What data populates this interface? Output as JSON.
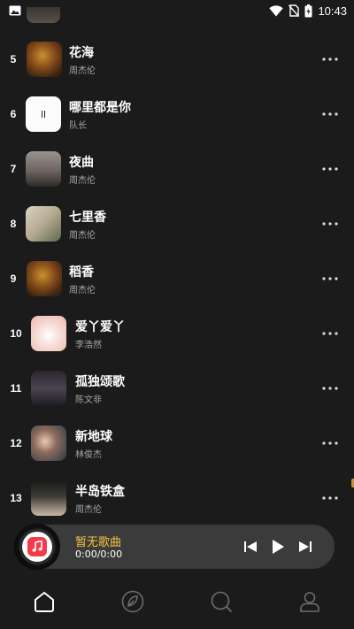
{
  "status_bar": {
    "time": "10:43",
    "icons": [
      "image-notification-icon",
      "wifi-icon",
      "no-sim-icon",
      "battery-charging-icon"
    ]
  },
  "songs": [
    {
      "index": "5",
      "title": "花海",
      "artist": "周杰伦",
      "cover": "flower-sea-cover"
    },
    {
      "index": "6",
      "title": "哪里都是你",
      "artist": "队长",
      "cover": "white-cover"
    },
    {
      "index": "7",
      "title": "夜曲",
      "artist": "周杰伦",
      "cover": "nocturne-cover"
    },
    {
      "index": "8",
      "title": "七里香",
      "artist": "周杰伦",
      "cover": "common-jasmine-cover"
    },
    {
      "index": "9",
      "title": "稻香",
      "artist": "周杰伦",
      "cover": "rice-field-cover"
    },
    {
      "index": "10",
      "title": "爱丫爱丫",
      "artist": "李浩然",
      "cover": "love-cover"
    },
    {
      "index": "11",
      "title": "孤独颂歌",
      "artist": "陈文非",
      "cover": "lonely-ode-cover"
    },
    {
      "index": "12",
      "title": "新地球",
      "artist": "林俊杰",
      "cover": "new-earth-cover"
    },
    {
      "index": "13",
      "title": "半岛铁盒",
      "artist": "周杰伦",
      "cover": "peninsula-box-cover"
    }
  ],
  "now_playing": {
    "title": "暂无歌曲",
    "time": "0:00/0:00"
  },
  "bottom_nav": [
    {
      "name": "home",
      "icon": "home-icon",
      "active": true
    },
    {
      "name": "discover",
      "icon": "leaf-icon",
      "active": false
    },
    {
      "name": "search",
      "icon": "search-icon",
      "active": false
    },
    {
      "name": "profile",
      "icon": "user-icon",
      "active": false
    }
  ],
  "colors": {
    "background": "#1b1b1b",
    "now_playing_title": "#f6c343",
    "player_bar": "#3b3b3b",
    "music_note_icon": "#f23c4b"
  }
}
